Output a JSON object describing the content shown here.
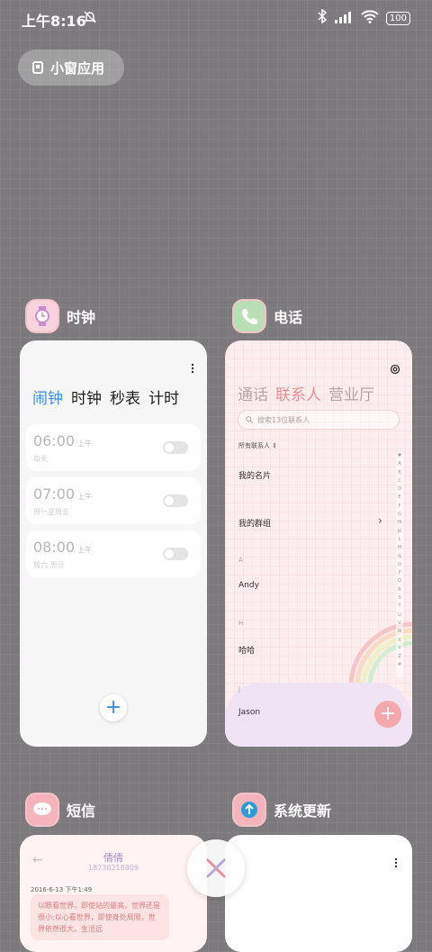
{
  "status": {
    "time": "上午8:16",
    "battery": "100"
  },
  "small_window": {
    "label": "小窗应用"
  },
  "clock_app": {
    "name": "时钟",
    "tabs": [
      "闹钟",
      "时钟",
      "秒表",
      "计时"
    ],
    "alarms": [
      {
        "time": "06:00",
        "ampm": "上午",
        "sub": "每天"
      },
      {
        "time": "07:00",
        "ampm": "上午",
        "sub": "周一至周五"
      },
      {
        "time": "08:00",
        "ampm": "上午",
        "sub": "周六 周日"
      }
    ],
    "add": "+"
  },
  "phone_app": {
    "name": "电话",
    "tabs": [
      "通话",
      "联系人",
      "营业厅"
    ],
    "search_placeholder": "搜索13位联系人",
    "filter": "所有联系人",
    "my_card": "我的名片",
    "my_groups": "我的群组",
    "sections": [
      {
        "letter": "A",
        "name": "Andy"
      },
      {
        "letter": "H",
        "name": "哈哈"
      },
      {
        "letter": "J",
        "name": "Jason"
      }
    ],
    "index_letters": "♥ABCDEFGHIJKLMNOPQRSTUVWXYZ#",
    "add": "+"
  },
  "sms_app": {
    "name": "短信",
    "contact": "倩倩",
    "number": "18730218809",
    "date": "2016-6-13 下午1:49",
    "message": "以眼看世界，即使站的最高，世界还是很小;以心看世界，即使身处局限，世界依然很大。生活远"
  },
  "update_app": {
    "name": "系统更新"
  },
  "colors": {
    "accent_blue": "#3b8fe4",
    "phone_accent": "#e9908f",
    "background": "#7c7a7c"
  }
}
